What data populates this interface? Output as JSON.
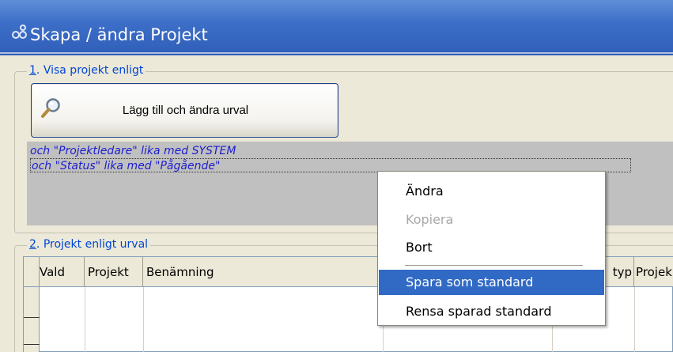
{
  "window": {
    "title": "Skapa / ändra Projekt",
    "icon": "project-app-icon"
  },
  "section1": {
    "number": "1",
    "legend": ". Visa projekt enligt",
    "search_button": {
      "label": "Lägg till och ändra urval",
      "icon": "search-icon"
    },
    "filters": [
      "och \"Projektledare\" lika med SYSTEM",
      "och \"Status\" lika med \"Pågående\""
    ]
  },
  "section2": {
    "number": "2",
    "legend": ". Projekt enligt urval",
    "columns": [
      "Vald",
      "Projekt",
      "Benämning",
      "typ",
      "Projek"
    ]
  },
  "context_menu": {
    "items": [
      {
        "label": "Ändra",
        "state": "normal"
      },
      {
        "label": "Kopiera",
        "state": "disabled"
      },
      {
        "label": "Bort",
        "state": "normal"
      },
      {
        "label": "Spara som standard",
        "state": "selected"
      },
      {
        "label": "Rensa sparad standard",
        "state": "normal"
      }
    ]
  },
  "colors": {
    "titlebar": "#3d6fc8",
    "legend_text": "#0046d5",
    "filter_text": "#1d1dcf",
    "menu_highlight": "#316ac5",
    "filter_background": "#c0c0c0"
  }
}
